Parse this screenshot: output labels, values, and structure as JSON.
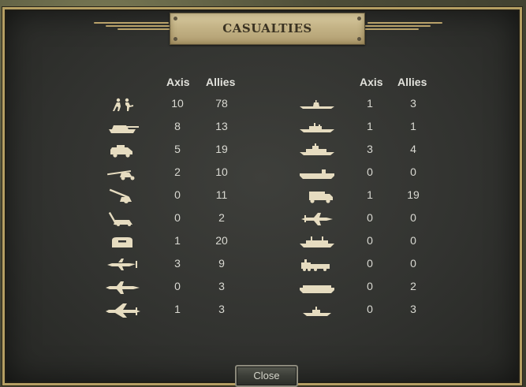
{
  "dialog": {
    "title": "CASUALTIES",
    "close_label": "Close"
  },
  "headers": {
    "axis": "Axis",
    "allies": "Allies"
  },
  "left_rows": [
    {
      "icon": "infantry-icon",
      "axis": "10",
      "allies": "78"
    },
    {
      "icon": "tank-icon",
      "axis": "8",
      "allies": "13"
    },
    {
      "icon": "armored-car-icon",
      "axis": "5",
      "allies": "19"
    },
    {
      "icon": "anti-tank-gun-icon",
      "axis": "2",
      "allies": "10"
    },
    {
      "icon": "artillery-icon",
      "axis": "0",
      "allies": "11"
    },
    {
      "icon": "anti-aircraft-gun-icon",
      "axis": "0",
      "allies": "2"
    },
    {
      "icon": "bunker-icon",
      "axis": "1",
      "allies": "20"
    },
    {
      "icon": "fighter-plane-icon",
      "axis": "3",
      "allies": "9"
    },
    {
      "icon": "tactical-bomber-icon",
      "axis": "0",
      "allies": "3"
    },
    {
      "icon": "strategic-bomber-icon",
      "axis": "1",
      "allies": "3"
    }
  ],
  "right_rows": [
    {
      "icon": "submarine-icon",
      "axis": "1",
      "allies": "3"
    },
    {
      "icon": "destroyer-icon",
      "axis": "1",
      "allies": "1"
    },
    {
      "icon": "cruiser-icon",
      "axis": "3",
      "allies": "4"
    },
    {
      "icon": "aircraft-carrier-icon",
      "axis": "0",
      "allies": "0"
    },
    {
      "icon": "truck-icon",
      "axis": "1",
      "allies": "19"
    },
    {
      "icon": "transport-plane-icon",
      "axis": "0",
      "allies": "0"
    },
    {
      "icon": "transport-ship-icon",
      "axis": "0",
      "allies": "0"
    },
    {
      "icon": "train-icon",
      "axis": "0",
      "allies": "0"
    },
    {
      "icon": "landing-craft-icon",
      "axis": "0",
      "allies": "2"
    },
    {
      "icon": "patrol-boat-icon",
      "axis": "0",
      "allies": "3"
    }
  ],
  "colors": {
    "border": "#b59f63",
    "plate": "#c4b386",
    "icon": "#e6dcc0"
  }
}
